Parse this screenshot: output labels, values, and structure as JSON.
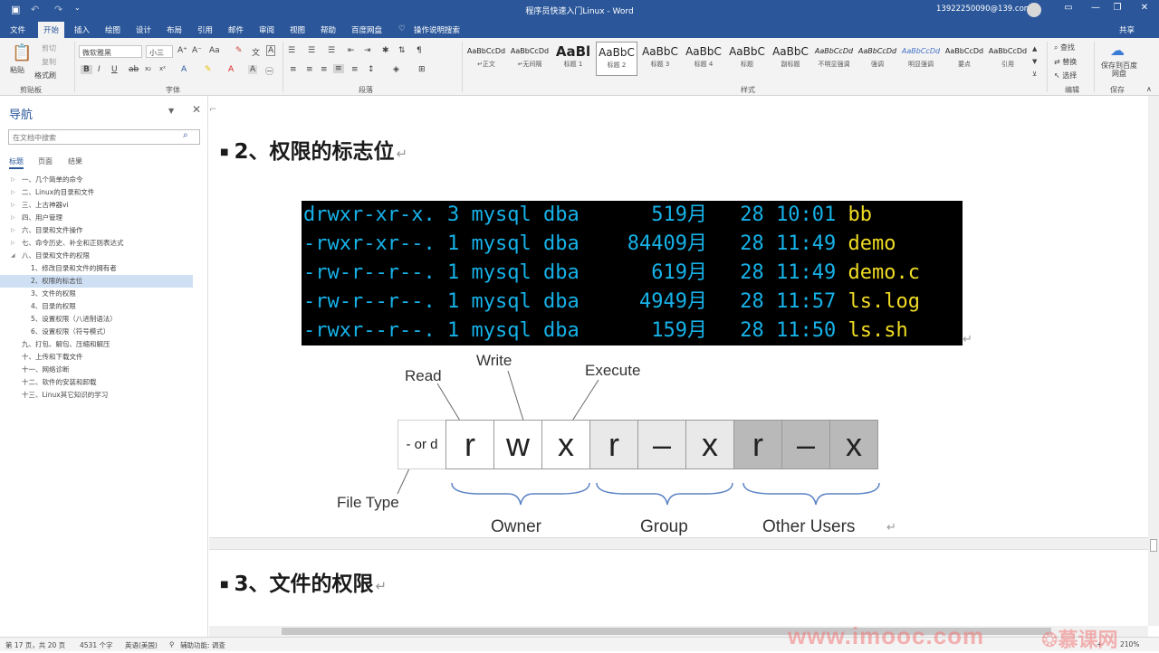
{
  "titlebar": {
    "doc_title": "程序员快速入门Linux  -  Word",
    "user": "13922250090@139.com",
    "save_icon": "save-icon",
    "undo_icon": "undo-icon",
    "redo_icon": "redo-icon"
  },
  "tabs": [
    "文件",
    "开始",
    "插入",
    "绘图",
    "设计",
    "布局",
    "引用",
    "邮件",
    "审阅",
    "视图",
    "帮助",
    "百度网盘"
  ],
  "tell_me": "操作说明搜索",
  "share": "共享",
  "ribbon": {
    "clipboard": {
      "paste": "粘贴",
      "cut": "剪切",
      "copy": "复制",
      "format_painter": "格式刷",
      "label": "剪贴板"
    },
    "font": {
      "name": "微软雅黑",
      "size": "小三",
      "label": "字体"
    },
    "paragraph": {
      "label": "段落"
    },
    "styles": {
      "label": "样式",
      "items": [
        {
          "preview": "AaBbCcDd",
          "name": "↵正文"
        },
        {
          "preview": "AaBbCcDd",
          "name": "↵无间隔"
        },
        {
          "preview": "AaBl",
          "name": "标题 1"
        },
        {
          "preview": "AaBbC",
          "name": "标题 2"
        },
        {
          "preview": "AaBbC",
          "name": "标题 3"
        },
        {
          "preview": "AaBbC",
          "name": "标题 4"
        },
        {
          "preview": "AaBbC",
          "name": "标题"
        },
        {
          "preview": "AaBbC",
          "name": "副标题"
        },
        {
          "preview": "AaBbCcDd",
          "name": "不明显强调"
        },
        {
          "preview": "AaBbCcDd",
          "name": "强调"
        },
        {
          "preview": "AaBbCcDd",
          "name": "明显强调"
        },
        {
          "preview": "AaBbCcDd",
          "name": "要点"
        },
        {
          "preview": "AaBbCcDd",
          "name": "引用"
        }
      ]
    },
    "editing": {
      "find": "查找",
      "replace": "替换",
      "select": "选择",
      "label": "编辑"
    },
    "save": {
      "btn": "保存到百度网盘",
      "label": "保存"
    }
  },
  "nav": {
    "title": "导航",
    "search_placeholder": "在文档中搜索",
    "tabs": [
      "标题",
      "页面",
      "结果"
    ],
    "items": [
      {
        "text": "一、几个简单的命令",
        "level": 0,
        "arrow": "▷"
      },
      {
        "text": "二、Linux的目录和文件",
        "level": 0,
        "arrow": "▷"
      },
      {
        "text": "三、上古神器vi",
        "level": 0,
        "arrow": "▷"
      },
      {
        "text": "四、用户管理",
        "level": 0,
        "arrow": "▷"
      },
      {
        "text": "六、目录和文件操作",
        "level": 0,
        "arrow": "▷"
      },
      {
        "text": "七、命令历史、补全和正则表达式",
        "level": 0,
        "arrow": "▷"
      },
      {
        "text": "八、目录和文件的权限",
        "level": 0,
        "arrow": "◢"
      },
      {
        "text": "1、修改目录和文件的拥有者",
        "level": 1,
        "arrow": ""
      },
      {
        "text": "2、权限的标志位",
        "level": 1,
        "arrow": "",
        "selected": true
      },
      {
        "text": "3、文件的权限",
        "level": 1,
        "arrow": ""
      },
      {
        "text": "4、目录的权限",
        "level": 1,
        "arrow": ""
      },
      {
        "text": "5、设置权限（八进制语法）",
        "level": 1,
        "arrow": ""
      },
      {
        "text": "6、设置权限（符号模式）",
        "level": 1,
        "arrow": ""
      },
      {
        "text": "九、打包、解包、压缩和解压",
        "level": 0,
        "arrow": ""
      },
      {
        "text": "十、上传和下载文件",
        "level": 0,
        "arrow": ""
      },
      {
        "text": "十一、网络诊断",
        "level": 0,
        "arrow": ""
      },
      {
        "text": "十二、软件的安装和卸载",
        "level": 0,
        "arrow": ""
      },
      {
        "text": "十三、Linux其它知识的学习",
        "level": 0,
        "arrow": ""
      }
    ]
  },
  "doc": {
    "heading1": "2、权限的标志位",
    "heading2": "3、文件的权限",
    "terminal": [
      {
        "perm": "drwxr-xr-x.",
        "links": "3",
        "owner": "mysql",
        "group": "dba",
        "size": "51",
        "month": "9月",
        "day": "28",
        "time": "10:01",
        "name": "bb"
      },
      {
        "perm": "-rwxr-xr--.",
        "links": "1",
        "owner": "mysql",
        "group": "dba",
        "size": "8440",
        "month": "9月",
        "day": "28",
        "time": "11:49",
        "name": "demo"
      },
      {
        "perm": "-rw-r--r--.",
        "links": "1",
        "owner": "mysql",
        "group": "dba",
        "size": "61",
        "month": "9月",
        "day": "28",
        "time": "11:49",
        "name": "demo.c"
      },
      {
        "perm": "-rw-r--r--.",
        "links": "1",
        "owner": "mysql",
        "group": "dba",
        "size": "494",
        "month": "9月",
        "day": "28",
        "time": "11:57",
        "name": "ls.log"
      },
      {
        "perm": "-rwxr--r--.",
        "links": "1",
        "owner": "mysql",
        "group": "dba",
        "size": "15",
        "month": "9月",
        "day": "28",
        "time": "11:50",
        "name": "ls.sh"
      }
    ],
    "diagram": {
      "type_cell": "- or d",
      "cells": [
        "r",
        "w",
        "x",
        "r",
        "–",
        "x",
        "r",
        "–",
        "x"
      ],
      "labels": {
        "read": "Read",
        "write": "Write",
        "execute": "Execute",
        "file_type": "File Type",
        "owner": "Owner",
        "group": "Group",
        "other": "Other Users"
      }
    }
  },
  "status": {
    "page": "第 17 页，共 20 页",
    "words": "4531 个字",
    "lang": "英语(美国)",
    "accessibility": "辅助功能: 调查",
    "zoom": "210%"
  },
  "watermark": {
    "site": "www.imooc.com",
    "brand": "慕课网"
  }
}
